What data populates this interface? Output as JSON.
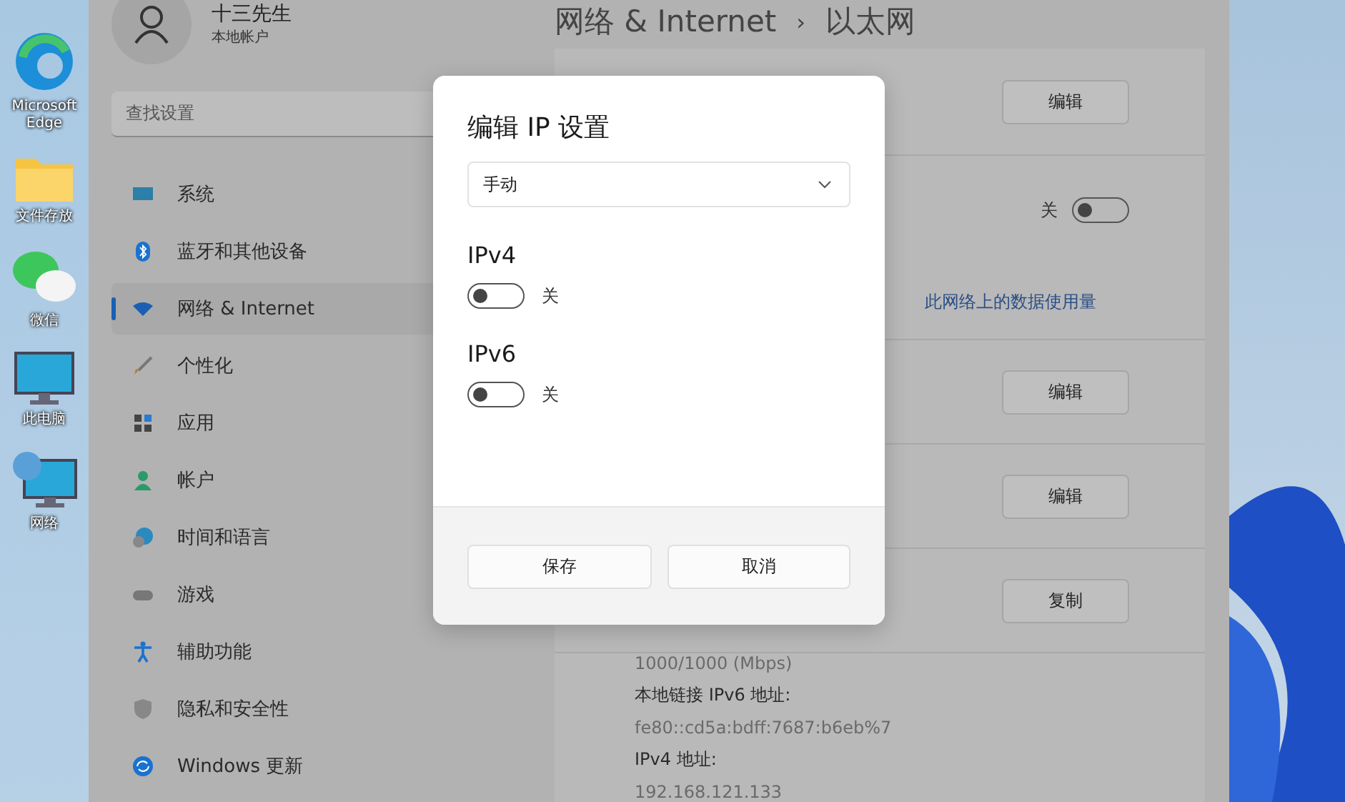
{
  "desktop_icons": [
    {
      "label": "Microsoft Edge",
      "kind": "edge"
    },
    {
      "label": "文件存放",
      "kind": "folder"
    },
    {
      "label": "微信",
      "kind": "chat"
    },
    {
      "label": "此电脑",
      "kind": "pc"
    },
    {
      "label": "网络",
      "kind": "network"
    }
  ],
  "account": {
    "name": "十三先生",
    "type": "本地帐户"
  },
  "search": {
    "placeholder": "查找设置"
  },
  "nav": [
    {
      "label": "系统",
      "selected": false
    },
    {
      "label": "蓝牙和其他设备",
      "selected": false
    },
    {
      "label": "网络 & Internet",
      "selected": true
    },
    {
      "label": "个性化",
      "selected": false
    },
    {
      "label": "应用",
      "selected": false
    },
    {
      "label": "帐户",
      "selected": false
    },
    {
      "label": "时间和语言",
      "selected": false
    },
    {
      "label": "游戏",
      "selected": false
    },
    {
      "label": "辅助功能",
      "selected": false
    },
    {
      "label": "隐私和安全性",
      "selected": false
    },
    {
      "label": "Windows 更新",
      "selected": false
    }
  ],
  "breadcrumb": {
    "parent": "网络 & Internet",
    "separator": "›",
    "current": "以太网"
  },
  "rows": [
    {
      "kind": "button",
      "label": "编辑"
    },
    {
      "kind": "toggle",
      "label": "关",
      "on": false
    },
    {
      "kind": "link",
      "label": "此网络上的数据使用量"
    },
    {
      "kind": "button",
      "label": "编辑"
    },
    {
      "kind": "button",
      "label": "编辑"
    },
    {
      "kind": "button",
      "label": "复制"
    }
  ],
  "details": [
    {
      "kind": "value",
      "text": "1000/1000 (Mbps)"
    },
    {
      "kind": "label",
      "text": "本地链接 IPv6 地址:"
    },
    {
      "kind": "value",
      "text": "fe80::cd5a:bdff:7687:b6eb%7"
    },
    {
      "kind": "label",
      "text": "IPv4 地址:"
    },
    {
      "kind": "value",
      "text": "192.168.121.133"
    }
  ],
  "dialog": {
    "title": "编辑 IP 设置",
    "mode": "手动",
    "sections": [
      {
        "title": "IPv4",
        "on": false,
        "state_label": "关"
      },
      {
        "title": "IPv6",
        "on": false,
        "state_label": "关"
      }
    ],
    "buttons": [
      {
        "label": "保存"
      },
      {
        "label": "取消"
      }
    ]
  }
}
